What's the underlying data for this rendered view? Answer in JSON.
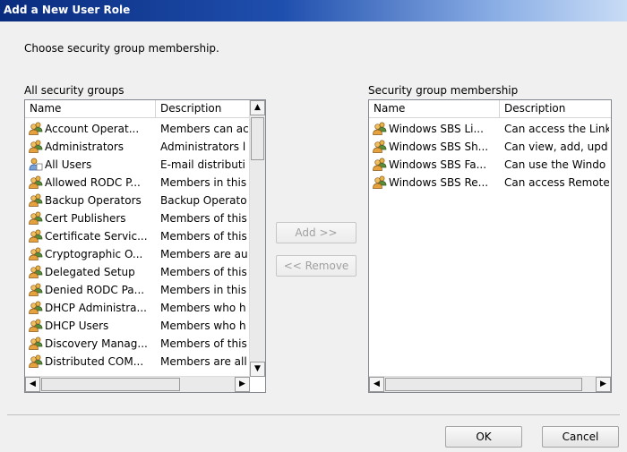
{
  "window": {
    "title": "Add a New User Role"
  },
  "instruction": "Choose security group membership.",
  "all_groups": {
    "label": "All security groups",
    "columns": [
      "Name",
      "Description"
    ],
    "rows": [
      {
        "name": "Account Operat...",
        "desc": "Members can ac"
      },
      {
        "name": "Administrators",
        "desc": "Administrators l"
      },
      {
        "name": "All Users",
        "desc": "E-mail distributi"
      },
      {
        "name": "Allowed RODC P...",
        "desc": "Members in this"
      },
      {
        "name": "Backup Operators",
        "desc": "Backup Operato"
      },
      {
        "name": "Cert Publishers",
        "desc": "Members of this"
      },
      {
        "name": "Certificate Servic...",
        "desc": "Members of this"
      },
      {
        "name": "Cryptographic O...",
        "desc": "Members are au"
      },
      {
        "name": "Delegated Setup",
        "desc": "Members of this"
      },
      {
        "name": "Denied RODC Pa...",
        "desc": "Members in this"
      },
      {
        "name": "DHCP Administra...",
        "desc": "Members who h"
      },
      {
        "name": "DHCP Users",
        "desc": "Members who h"
      },
      {
        "name": "Discovery Manag...",
        "desc": "Members of this"
      },
      {
        "name": "Distributed COM...",
        "desc": "Members are all"
      }
    ]
  },
  "membership": {
    "label": "Security group membership",
    "columns": [
      "Name",
      "Description"
    ],
    "rows": [
      {
        "name": "Windows SBS Li...",
        "desc": "Can access the Link"
      },
      {
        "name": "Windows SBS Sh...",
        "desc": "Can view, add, upd"
      },
      {
        "name": "Windows SBS Fa...",
        "desc": "Can use the Windo"
      },
      {
        "name": "Windows SBS Re...",
        "desc": "Can access Remote"
      }
    ]
  },
  "buttons": {
    "add": "Add >>",
    "remove": "<< Remove",
    "ok": "OK",
    "cancel": "Cancel"
  },
  "scroll": {
    "up": "▲",
    "down": "▼",
    "left": "◀",
    "right": "▶"
  },
  "icons": {
    "group": "group-icon",
    "distribution": "distribution-list-icon"
  }
}
